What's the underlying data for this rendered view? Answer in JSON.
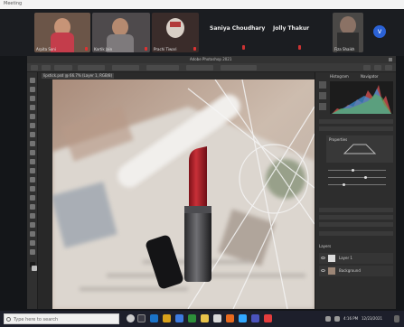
{
  "window": {
    "title": "Meeting"
  },
  "meeting": {
    "participants": [
      {
        "name": "Arpita Soni"
      },
      {
        "name": "Kartik Jain"
      },
      {
        "name": "Prachi Tiwari"
      },
      {
        "name": "Saniya Choudhary"
      },
      {
        "name": "Jolly Thakur"
      },
      {
        "name": "Fiza Shaikh"
      }
    ],
    "more_label": "v"
  },
  "photoshop": {
    "window_title": "Adobe Photoshop 2021",
    "document_tab": "lipstick.psd @ 66.7% (Layer 1, RGB/8)",
    "panels": {
      "histogram_tab": "Histogram",
      "navigator_tab": "Navigator",
      "properties_tab": "Properties",
      "layers_tab": "Layers",
      "layer_names": [
        "Layer 1",
        "Background"
      ]
    }
  },
  "taskbar": {
    "search_placeholder": "Type here to search",
    "time": "4:16 PM",
    "date": "12/23/2021"
  },
  "colors": {
    "accent": "#2b62d6",
    "lipstick": "#b3222c"
  }
}
